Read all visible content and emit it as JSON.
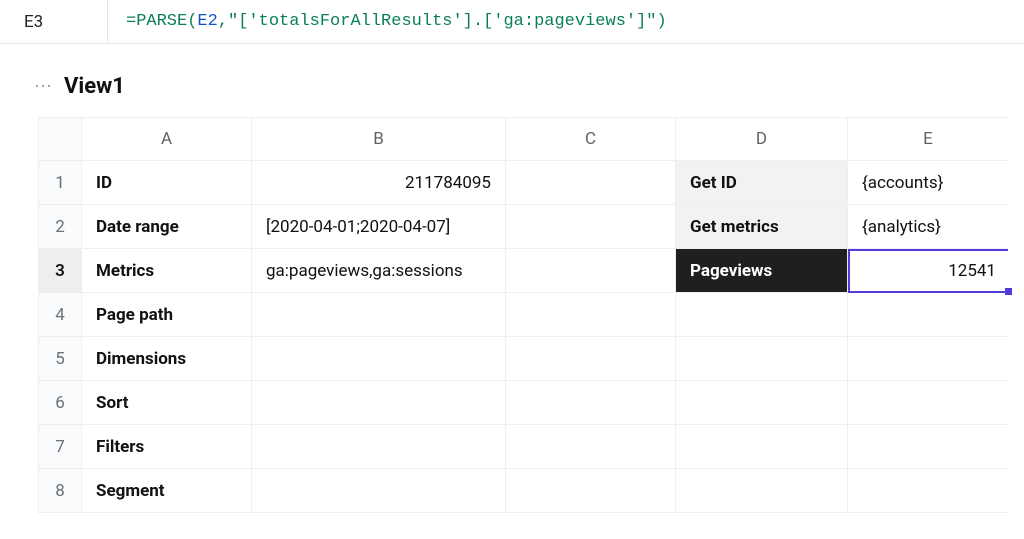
{
  "formula_bar": {
    "cell_ref": "E3",
    "parts": {
      "eq": "=",
      "func": "PARSE",
      "open": "(",
      "arg_cell": "E2",
      "comma": ",",
      "arg_str": "\"['totalsForAllResults'].['ga:pageviews']\"",
      "close": ")"
    }
  },
  "sheet": {
    "name": "View1",
    "columns": [
      "A",
      "B",
      "C",
      "D",
      "E"
    ],
    "row_numbers": [
      "1",
      "2",
      "3",
      "4",
      "5",
      "6",
      "7",
      "8"
    ],
    "active_row_index": 2,
    "selected_cell": "E3"
  },
  "cells": {
    "A1": "ID",
    "B1": "211784095",
    "D1": "Get ID",
    "E1": "{accounts}",
    "A2": "Date range",
    "B2": "[2020-04-01;2020-04-07]",
    "D2": "Get metrics",
    "E2": "{analytics}",
    "A3": "Metrics",
    "B3": "ga:pageviews,ga:sessions",
    "D3": "Pageviews",
    "E3": "12541",
    "A4": "Page path",
    "A5": "Dimensions",
    "A6": "Sort",
    "A7": "Filters",
    "A8": "Segment"
  }
}
